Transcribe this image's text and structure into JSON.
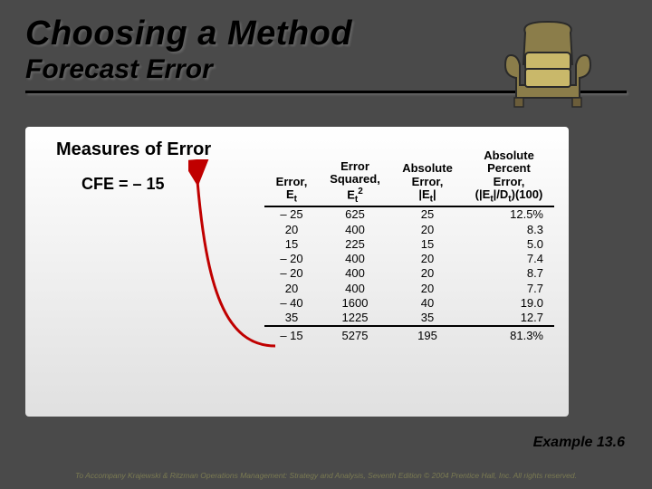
{
  "title": "Choosing a Method",
  "subtitle": "Forecast Error",
  "content": {
    "measures_title": "Measures of Error",
    "cfe_line": "CFE = – 15"
  },
  "table": {
    "headers": {
      "c1_l1": "Error,",
      "c1_l2": "E",
      "c1_sub": "t",
      "c2_l1": "Error",
      "c2_l2": "Squared,",
      "c2_l3": "E",
      "c2_sub": "t",
      "c2_sup": "2",
      "c3_l1": "Absolute",
      "c3_l2": "Error,",
      "c3_l3": "|E",
      "c3_sub": "t",
      "c3_l4": "|",
      "c4_l1": "Absolute",
      "c4_l2": "Percent",
      "c4_l3": "Error,",
      "c4_l4a": "(|E",
      "c4_sub1": "t",
      "c4_l4b": "|/D",
      "c4_sub2": "t",
      "c4_l4c": ")(100)"
    },
    "rows": [
      {
        "et": "– 25",
        "esq": "625",
        "abse": "25",
        "ape": "12.5%"
      },
      {
        "et": "20",
        "esq": "400",
        "abse": "20",
        "ape": "8.3"
      },
      {
        "et": "15",
        "esq": "225",
        "abse": "15",
        "ape": "5.0"
      },
      {
        "et": "– 20",
        "esq": "400",
        "abse": "20",
        "ape": "7.4"
      },
      {
        "et": "– 20",
        "esq": "400",
        "abse": "20",
        "ape": "8.7"
      },
      {
        "et": "20",
        "esq": "400",
        "abse": "20",
        "ape": "7.7"
      },
      {
        "et": "– 40",
        "esq": "1600",
        "abse": "40",
        "ape": "19.0"
      },
      {
        "et": "35",
        "esq": "1225",
        "abse": "35",
        "ape": "12.7"
      }
    ],
    "totals": {
      "et": "– 15",
      "esq": "5275",
      "abse": "195",
      "ape": "81.3%"
    }
  },
  "example_label": "Example 13.6",
  "footer": "To Accompany Krajewski & Ritzman Operations Management: Strategy and Analysis, Seventh Edition © 2004 Prentice Hall, Inc. All rights reserved."
}
